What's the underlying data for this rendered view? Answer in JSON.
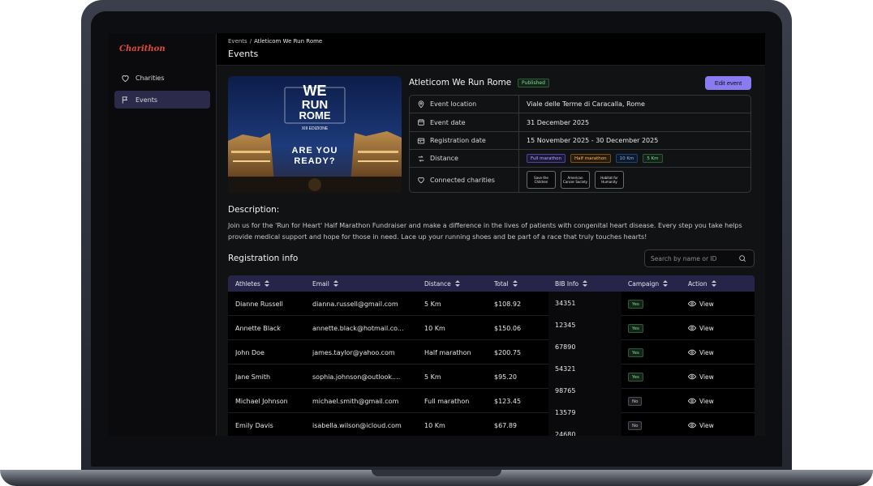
{
  "app": {
    "logo_text": "Charithon"
  },
  "sidebar": {
    "items": [
      {
        "label": "Charities",
        "icon": "heart-icon"
      },
      {
        "label": "Events",
        "icon": "flag-icon",
        "active": true
      }
    ]
  },
  "header": {
    "breadcrumb": {
      "parent": "Events",
      "separator": "/",
      "current": "Atleticom We Run Rome"
    },
    "title": "Events"
  },
  "event": {
    "hero_text": {
      "line1": "WE",
      "line2": "RUN",
      "line3": "ROME",
      "edition": "XIII EDIZIONE",
      "tagline1": "ARE YOU",
      "tagline2": "READY?"
    },
    "title": "Atleticom We Run Rome",
    "status": "Published",
    "edit_label": "Edit event",
    "details": {
      "location_label": "Event location",
      "location_value": "Viale delle Terme di Caracalla, Rome",
      "date_label": "Event date",
      "date_value": "31 December 2025",
      "reg_label": "Registration date",
      "reg_value": "15 November 2025 - 30 December 2025",
      "distance_label": "Distance",
      "distances": [
        "Full marathon",
        "Half marathon",
        "10 Km",
        "5 Km"
      ],
      "charities_label": "Connected charities",
      "charities": [
        "Save the Children",
        "American Cancer Society",
        "Habitat for Humanity"
      ]
    }
  },
  "description": {
    "title": "Description:",
    "text": "Join us for the 'Run for Heart' Half Marathon Fundraiser and make a difference in the lives of patients with congenital heart disease. Every step you take helps provide medical support and hope for those in need. Lace up your running shoes and be part of a race that truly touches hearts!"
  },
  "registration": {
    "title": "Registration info",
    "search_placeholder": "Search by name or ID",
    "columns": [
      "Athletes",
      "Email",
      "Distance",
      "Total",
      "BIB Info",
      "Campaign",
      "Action"
    ],
    "view_label": "View",
    "rows": [
      {
        "athlete": "Dianne Russell",
        "email": "dianna.russell@gmail.com",
        "distance": "5 Km",
        "total": "$108.92",
        "bib": "34351",
        "campaign": "Yes"
      },
      {
        "athlete": "Annette Black",
        "email": "annette.black@hotmail.co...",
        "distance": "10 Km",
        "total": "$150.06",
        "bib": "12345",
        "campaign": "Yes"
      },
      {
        "athlete": "John Doe",
        "email": "james.taylor@yahoo.com",
        "distance": "Half marathon",
        "total": "$200.75",
        "bib": "67890",
        "campaign": "Yes"
      },
      {
        "athlete": "Jane Smith",
        "email": "sophia.johnson@outlook....",
        "distance": "5 Km",
        "total": "$95.20",
        "bib": "54321",
        "campaign": "Yes"
      },
      {
        "athlete": "Michael Johnson",
        "email": "michael.smith@gmail.com",
        "distance": "Full marathon",
        "total": "$123.45",
        "bib": "98765",
        "campaign": "No"
      },
      {
        "athlete": "Emily Davis",
        "email": "isabella.wilson@icloud.com",
        "distance": "10 Km",
        "total": "$67.89",
        "bib": "13579",
        "campaign": "No"
      }
    ],
    "extra_bib": "24680"
  }
}
